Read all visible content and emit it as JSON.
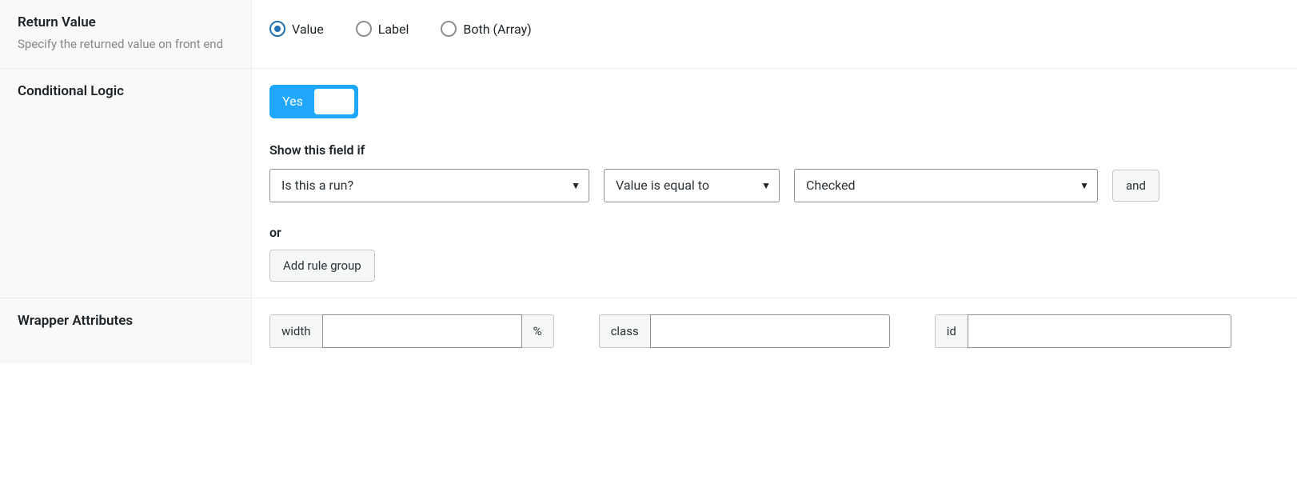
{
  "return_value": {
    "title": "Return Value",
    "desc": "Specify the returned value on front end",
    "options": {
      "value": "Value",
      "label": "Label",
      "both": "Both (Array)"
    }
  },
  "conditional": {
    "title": "Conditional Logic",
    "toggle": "Yes",
    "subtitle": "Show this field if",
    "rule": {
      "field": "Is this a run?",
      "operator": "Value is equal to",
      "value": "Checked",
      "and_btn": "and"
    },
    "or_label": "or",
    "add_group_btn": "Add rule group"
  },
  "wrapper": {
    "title": "Wrapper Attributes",
    "width_label": "width",
    "percent_label": "%",
    "class_label": "class",
    "id_label": "id"
  }
}
